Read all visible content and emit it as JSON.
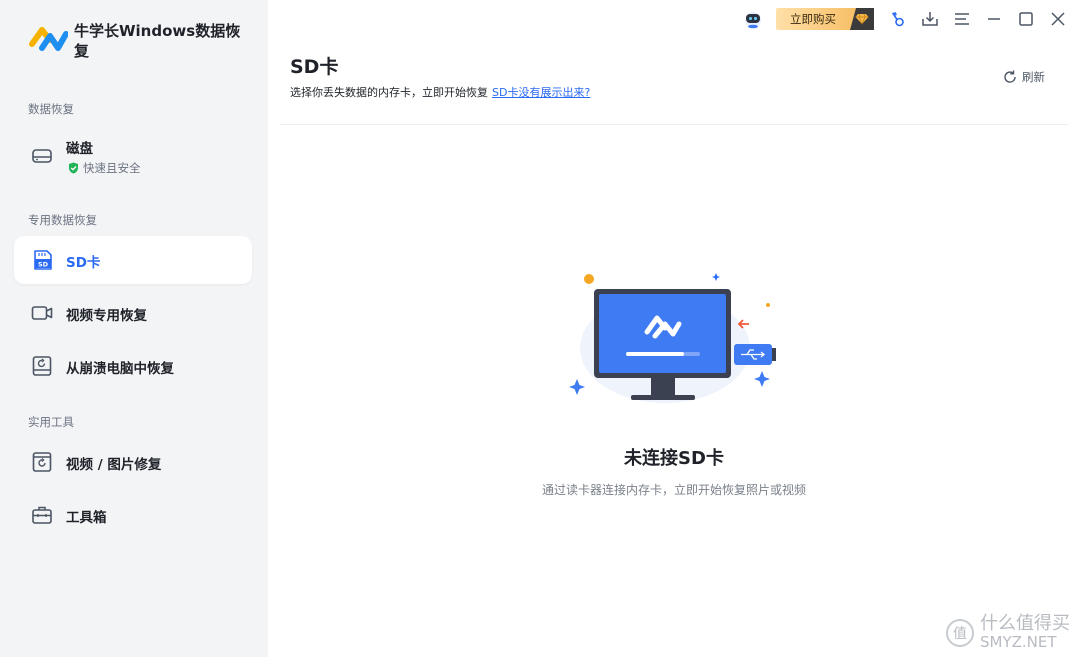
{
  "app": {
    "title": "牛学长Windows数据恢复"
  },
  "sidebar": {
    "section_data_recovery": "数据恢复",
    "disk": {
      "label": "磁盘",
      "sub": "快速且安全"
    },
    "section_special": "专用数据恢复",
    "items_special": [
      {
        "label": "SD卡",
        "icon": "sd-card-icon",
        "active": true
      },
      {
        "label": "视频专用恢复",
        "icon": "video-camera-icon"
      },
      {
        "label": "从崩溃电脑中恢复",
        "icon": "crashed-pc-icon"
      }
    ],
    "section_tools": "实用工具",
    "items_tools": [
      {
        "label": "视频 / 图片修复",
        "icon": "media-repair-icon"
      },
      {
        "label": "工具箱",
        "icon": "toolbox-icon"
      }
    ]
  },
  "topbar": {
    "buy_label": "立即购买",
    "icons": [
      "robot-assistant-icon",
      "key-icon",
      "download-icon",
      "menu-icon",
      "minimize-icon",
      "maximize-icon",
      "close-icon"
    ]
  },
  "main": {
    "title": "SD卡",
    "desc": "选择你丢失数据的内存卡，立即开始恢复",
    "help_link": "SD卡没有展示出来?",
    "refresh_label": "刷新",
    "empty_title": "未连接SD卡",
    "empty_desc": "通过读卡器连接内存卡，立即开始恢复照片或视频"
  },
  "watermark": {
    "text": "什么值得买",
    "sub": "SMYZ.NET"
  },
  "colors": {
    "accent": "#2b6bf3",
    "sidebar_bg": "#f3f4f6",
    "buy_gold": "#f5b858",
    "safe_green": "#22b357"
  }
}
